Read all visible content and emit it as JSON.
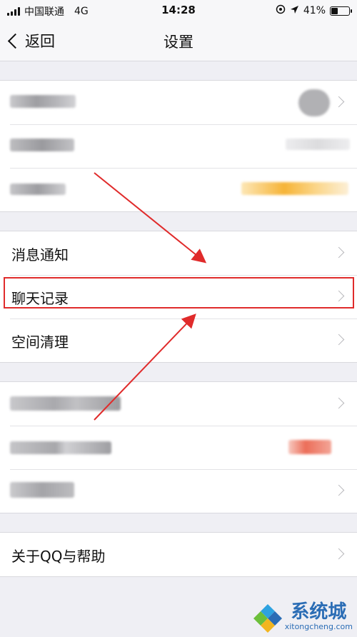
{
  "status_bar": {
    "carrier": "中国联通",
    "network": "4G",
    "time": "14:28",
    "battery": "41%"
  },
  "nav": {
    "back_label": "返回",
    "title": "设置"
  },
  "group2": {
    "items": [
      {
        "label": "消息通知"
      },
      {
        "label": "聊天记录"
      },
      {
        "label": "空间清理"
      }
    ]
  },
  "group4": {
    "items": [
      {
        "label": "关于QQ与帮助"
      }
    ]
  },
  "watermark": {
    "name": "系统城",
    "url": "xitongcheng.com"
  },
  "icons": [
    "signal-icon",
    "location-lock-icon",
    "location-arrow-icon",
    "battery-icon",
    "back-chevron-icon",
    "chevron-right-icon"
  ],
  "colors": {
    "highlight": "#e02b2b",
    "background": "#efeff4"
  }
}
